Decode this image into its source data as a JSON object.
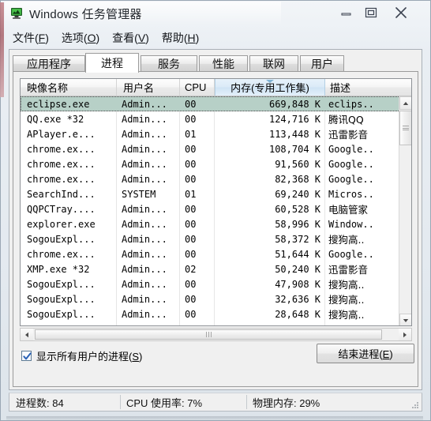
{
  "window": {
    "title": "Windows 任务管理器",
    "icon": "task-manager-icon",
    "controls": {
      "minimize": "minimize-icon",
      "maximize": "maximize-icon",
      "close": "close-icon"
    }
  },
  "menu": {
    "items": [
      {
        "label": "文件",
        "pre": "文件(",
        "acc": "F",
        "post": ")"
      },
      {
        "label": "选项",
        "pre": "选项(",
        "acc": "O",
        "post": ")"
      },
      {
        "label": "查看",
        "pre": "查看(",
        "acc": "V",
        "post": ")"
      },
      {
        "label": "帮助",
        "pre": "帮助(",
        "acc": "H",
        "post": ")"
      }
    ]
  },
  "tabs": {
    "active": "进程",
    "items": [
      {
        "label": "应用程序",
        "active": false
      },
      {
        "label": "进程",
        "active": true
      },
      {
        "label": "服务",
        "active": false
      },
      {
        "label": "性能",
        "active": false
      },
      {
        "label": "联网",
        "active": false
      },
      {
        "label": "用户",
        "active": false
      }
    ]
  },
  "process_list": {
    "columns": [
      {
        "label": "映像名称",
        "sorted": false,
        "align": "left"
      },
      {
        "label": "用户名",
        "sorted": false,
        "align": "left"
      },
      {
        "label": "CPU",
        "sorted": false,
        "align": "left"
      },
      {
        "label": "内存(专用工作集)",
        "sorted": true,
        "align": "right"
      },
      {
        "label": "描述",
        "sorted": false,
        "align": "left"
      }
    ],
    "sort_column": "内存(专用工作集)",
    "sort_direction": "descending",
    "selected_index": 0,
    "rows": [
      {
        "name": "eclipse.exe",
        "user": "Admin...",
        "cpu": "00",
        "memory": "669,848 K",
        "description": "eclips.."
      },
      {
        "name": "QQ.exe *32",
        "user": "Admin...",
        "cpu": "00",
        "memory": "124,716 K",
        "description": "腾讯QQ"
      },
      {
        "name": "APlayer.e...",
        "user": "Admin...",
        "cpu": "01",
        "memory": "113,448 K",
        "description": "迅雷影音"
      },
      {
        "name": "chrome.ex...",
        "user": "Admin...",
        "cpu": "00",
        "memory": "108,704 K",
        "description": "Google.."
      },
      {
        "name": "chrome.ex...",
        "user": "Admin...",
        "cpu": "00",
        "memory": "91,560 K",
        "description": "Google.."
      },
      {
        "name": "chrome.ex...",
        "user": "Admin...",
        "cpu": "00",
        "memory": "82,368 K",
        "description": "Google.."
      },
      {
        "name": "SearchInd...",
        "user": "SYSTEM",
        "cpu": "01",
        "memory": "69,240 K",
        "description": "Micros.."
      },
      {
        "name": "QQPCTray....",
        "user": "Admin...",
        "cpu": "00",
        "memory": "60,528 K",
        "description": "电脑管家"
      },
      {
        "name": "explorer.exe",
        "user": "Admin...",
        "cpu": "00",
        "memory": "58,996 K",
        "description": "Window.."
      },
      {
        "name": "SogouExpl...",
        "user": "Admin...",
        "cpu": "00",
        "memory": "58,372 K",
        "description": "搜狗高.."
      },
      {
        "name": "chrome.ex...",
        "user": "Admin...",
        "cpu": "00",
        "memory": "51,644 K",
        "description": "Google.."
      },
      {
        "name": "XMP.exe *32",
        "user": "Admin...",
        "cpu": "02",
        "memory": "50,240 K",
        "description": "迅雷影音"
      },
      {
        "name": "SogouExpl...",
        "user": "Admin...",
        "cpu": "00",
        "memory": "47,908 K",
        "description": "搜狗高.."
      },
      {
        "name": "SogouExpl...",
        "user": "Admin...",
        "cpu": "00",
        "memory": "32,636 K",
        "description": "搜狗高.."
      },
      {
        "name": "SogouExpl...",
        "user": "Admin...",
        "cpu": "00",
        "memory": "28,648 K",
        "description": "搜狗高.."
      }
    ]
  },
  "footer": {
    "show_all_users": {
      "checked": true,
      "pre": "显示所有用户的进程(",
      "acc": "S",
      "post": ")"
    },
    "end_process_button": {
      "pre": "结束进程(",
      "acc": "E",
      "post": ")"
    }
  },
  "status_bar": {
    "process_count": "进程数: 84",
    "cpu_usage": "CPU 使用率: 7%",
    "physical_memory": "物理内存: 29%"
  },
  "colors": {
    "selection": "#b7d0c7",
    "sorted_header": "#daeaf7",
    "window_bg": "#f0f0f0",
    "accent_red": "#a8636b"
  }
}
